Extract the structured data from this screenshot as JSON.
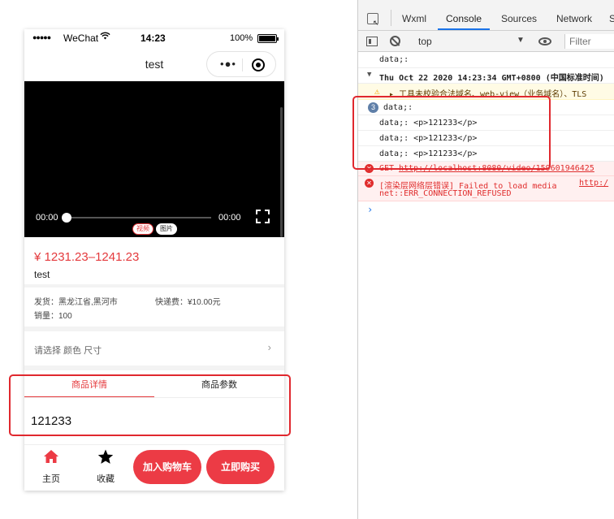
{
  "phone": {
    "status": {
      "signal": "●●●●●",
      "carrier": "WeChat",
      "wifi_icon": "wifi-icon",
      "time": "14:23",
      "battery": "100%"
    },
    "nav": {
      "title": "test",
      "more": "•●•"
    },
    "video": {
      "current_time": "00:00",
      "duration": "00:00",
      "progress": 0,
      "tab_video": "视频",
      "tab_image": "图片"
    },
    "product": {
      "price": "¥ 1231.23–1241.23",
      "title": "test",
      "ship_from": "发货：黑龙江省,黑河市",
      "shipping_fee": "快递费：¥10.00元",
      "sales": "销量：100"
    },
    "spec": {
      "label": "请选择 颜色 尺寸",
      "arrow": "›"
    },
    "tabs": {
      "detail": "商品详情",
      "params": "商品参数"
    },
    "detail_text": "121233",
    "bottom": {
      "home": "主页",
      "favorite": "收藏",
      "add_cart": "加入购物车",
      "buy_now": "立即购买"
    }
  },
  "devtools": {
    "tabs": [
      "Wxml",
      "Console",
      "Sources",
      "Network",
      "S"
    ],
    "active_tab": "Console",
    "context": "top",
    "filter_placeholder": "Filter",
    "console": {
      "line1": "data;:",
      "line2": "Thu Oct 22 2020 14:23:34 GMT+0800 (中国标准时间)",
      "line3": "▸ 工具未校验合法域名、web-view（业务域名）、TLS",
      "group_count": "3",
      "group_label": "data;:",
      "group_rows": [
        "data;:  <p>121233</p>",
        "data;:  <p>121233</p>",
        "data;:  <p>121233</p>"
      ],
      "err1_prefix": "GET ",
      "err1_url": "http://localhost:8080/video/159601946425",
      "err2_text": "[渲染层网络层错误] Failed to load media ",
      "err2_link": "http:/",
      "err2_cont": "net::ERR_CONNECTION_REFUSED",
      "prompt": "›"
    }
  },
  "colors": {
    "accent_red": "#e4393c",
    "button_red": "#ec3b45",
    "annotation_red": "#e0282e",
    "devtools_blue": "#1a73e8"
  }
}
